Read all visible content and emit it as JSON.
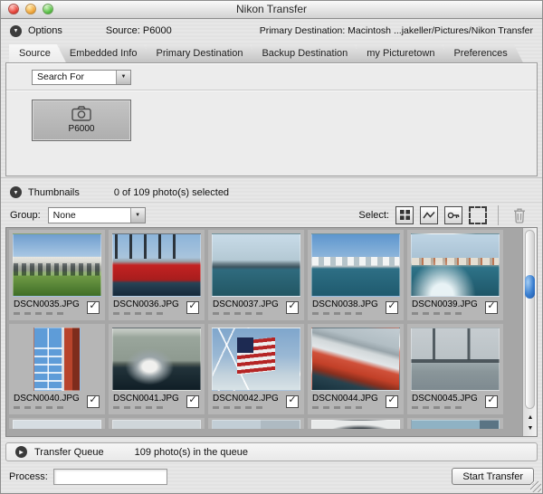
{
  "window": {
    "title": "Nikon Transfer"
  },
  "options_bar": {
    "label": "Options",
    "source_label": "Source: P6000",
    "primary_destination_label": "Primary Destination: Macintosh ...jakeller/Pictures/Nikon Transfer"
  },
  "tabs": {
    "items": [
      {
        "label": "Source",
        "active": true
      },
      {
        "label": "Embedded Info",
        "active": false
      },
      {
        "label": "Primary Destination",
        "active": false
      },
      {
        "label": "Backup Destination",
        "active": false
      },
      {
        "label": "my Picturetown",
        "active": false
      },
      {
        "label": "Preferences",
        "active": false
      }
    ]
  },
  "source_panel": {
    "search_dropdown_value": "Search For",
    "device_button": {
      "label": "P6000",
      "icon": "camera-icon",
      "selected": true
    }
  },
  "thumbnails_section": {
    "header_label": "Thumbnails",
    "selection_status": "0 of 109 photo(s) selected",
    "group_label": "Group:",
    "group_value": "None",
    "select_label": "Select:",
    "select_buttons": [
      "select-all-icon",
      "select-marked-icon",
      "select-protected-icon",
      "deselect-marquee-icon"
    ],
    "delete_icon": "trash-icon"
  },
  "photos": [
    {
      "filename": "DSCN0035.JPG",
      "checked": true
    },
    {
      "filename": "DSCN0036.JPG",
      "checked": true
    },
    {
      "filename": "DSCN0037.JPG",
      "checked": true
    },
    {
      "filename": "DSCN0038.JPG",
      "checked": true
    },
    {
      "filename": "DSCN0039.JPG",
      "checked": true
    },
    {
      "filename": "DSCN0040.JPG",
      "checked": true
    },
    {
      "filename": "DSCN0041.JPG",
      "checked": true
    },
    {
      "filename": "DSCN0042.JPG",
      "checked": true
    },
    {
      "filename": "DSCN0044.JPG",
      "checked": true
    },
    {
      "filename": "DSCN0045.JPG",
      "checked": true
    }
  ],
  "transfer_queue": {
    "header_label": "Transfer Queue",
    "status": "109 photo(s) in the queue"
  },
  "footer": {
    "process_label": "Process:",
    "process_value": "",
    "start_button_label": "Start Transfer"
  },
  "icons": {
    "check": "✓",
    "tri_down": "▼",
    "tri_right": "▶",
    "up_arrow": "▲",
    "down_arrow": "▼",
    "dd_arrow": "▼"
  },
  "colors": {
    "scroll_thumb_blue": "#2f6fc4",
    "window_bg": "#e4e4e4",
    "thumb_cell_bg": "#b6b6b6",
    "hull_red": "#c32222"
  }
}
